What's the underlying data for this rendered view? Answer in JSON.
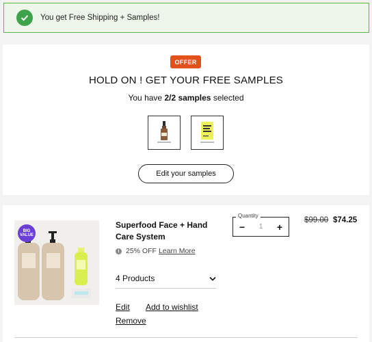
{
  "banner": {
    "text": "You get Free Shipping + Samples!",
    "icon": "check-icon",
    "accent": "#3ea34a"
  },
  "offer": {
    "badge": "OFFER",
    "title": "HOLD ON ! GET YOUR FREE SAMPLES",
    "samples_prefix": "You have ",
    "samples_count": "2/2 samples",
    "samples_suffix": " selected",
    "edit_button": "Edit your samples",
    "badge_color": "#e2511b"
  },
  "product": {
    "name": "Superfood Face + Hand Care System",
    "badge": "BIG VALUE",
    "discount": "25% OFF",
    "learn_more": "Learn More",
    "contents": "4 Products",
    "edit": "Edit",
    "wishlist": "Add to wishlist",
    "remove": "Remove",
    "quantity_label": "Quantity",
    "quantity_value": "1",
    "decrement": "−",
    "increment": "+",
    "price_old": "$99.00",
    "price_new": "$74.25"
  }
}
